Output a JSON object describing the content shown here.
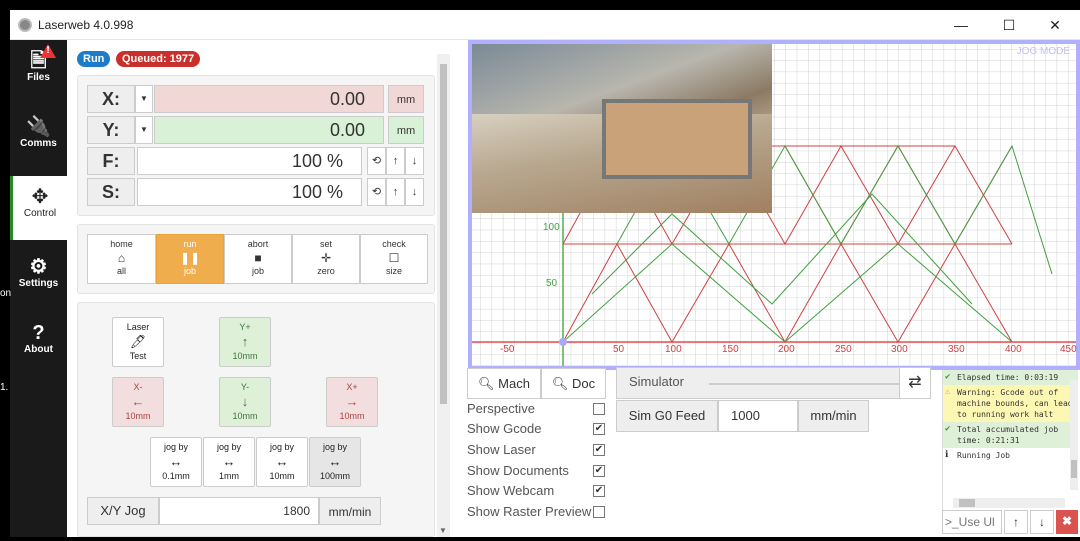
{
  "window": {
    "title": "Laserweb 4.0.998",
    "minimize": "—",
    "maximize": "☐",
    "close": "✕"
  },
  "desktop": {
    "left_label_1": "on",
    "left_label_2": "1."
  },
  "sidebar": {
    "items": [
      {
        "label": "Files",
        "icon": "file-icon"
      },
      {
        "label": "Comms",
        "icon": "plug-icon"
      },
      {
        "label": "Control",
        "icon": "move-icon"
      },
      {
        "label": "Settings",
        "icon": "gears-icon"
      },
      {
        "label": "About",
        "icon": "question-icon"
      }
    ]
  },
  "status": {
    "run": "Run",
    "queued": "Queued: 1977"
  },
  "dro": {
    "x": {
      "label": "X:",
      "value": "0.00",
      "unit": "mm",
      "color": "#f2d7d7"
    },
    "y": {
      "label": "Y:",
      "value": "0.00",
      "unit": "mm",
      "color": "#d9f2d7"
    },
    "f": {
      "label": "F:",
      "value": "100 %"
    },
    "s": {
      "label": "S:",
      "value": "100 %"
    }
  },
  "job_buttons": [
    {
      "top": "home",
      "bottom": "all",
      "icon": "home-icon"
    },
    {
      "top": "run",
      "bottom": "job",
      "icon": "pause-icon"
    },
    {
      "top": "abort",
      "bottom": "job",
      "icon": "stop-icon"
    },
    {
      "top": "set",
      "bottom": "zero",
      "icon": "crosshair-icon"
    },
    {
      "top": "check",
      "bottom": "size",
      "icon": "square-icon"
    }
  ],
  "jog": {
    "laser_test": {
      "top": "Laser",
      "bottom": "Test"
    },
    "y_plus": {
      "top": "Y+",
      "bottom": "10mm"
    },
    "x_minus": {
      "top": "X-",
      "bottom": "10mm"
    },
    "y_minus": {
      "top": "Y-",
      "bottom": "10mm"
    },
    "x_plus": {
      "top": "X+",
      "bottom": "10mm"
    },
    "steps": [
      {
        "top": "jog by",
        "bottom": "0.1mm"
      },
      {
        "top": "jog by",
        "bottom": "1mm"
      },
      {
        "top": "jog by",
        "bottom": "10mm"
      },
      {
        "top": "jog by",
        "bottom": "100mm"
      }
    ],
    "xy_jog": {
      "label": "X/Y Jog",
      "value": "1800",
      "unit": "mm/min"
    }
  },
  "viewport": {
    "jog_mode": "JOG MODE",
    "x_ticks": [
      "-50",
      "50",
      "100",
      "150",
      "200",
      "250",
      "300",
      "350",
      "400",
      "450"
    ],
    "y_ticks": [
      "100",
      "50"
    ]
  },
  "view_controls": {
    "mach": "Mach",
    "doc": "Doc",
    "simulator": "Simulator",
    "sim_feed_label": "Sim G0 Feed",
    "sim_feed_value": "1000",
    "sim_feed_unit": "mm/min"
  },
  "toggles": [
    {
      "label": "Perspective",
      "checked": false
    },
    {
      "label": "Show Gcode",
      "checked": true
    },
    {
      "label": "Show Laser",
      "checked": true
    },
    {
      "label": "Show Documents",
      "checked": true
    },
    {
      "label": "Show Webcam",
      "checked": true
    },
    {
      "label": "Show Raster Preview",
      "checked": false
    }
  ],
  "log": [
    {
      "type": "green",
      "icon": "check-circle-icon",
      "text": "Elapsed time: 0:03:19"
    },
    {
      "type": "warn",
      "icon": "warning-icon",
      "text": "Warning: Gcode out of machine bounds, can lead to running work halt"
    },
    {
      "type": "green",
      "icon": "check-circle-icon",
      "text": "Total accumulated job time: 0:21:31"
    },
    {
      "type": "info",
      "icon": "info-circle-icon",
      "text": "Running Job"
    }
  ],
  "command": {
    "placeholder": ">_Use Ul"
  }
}
